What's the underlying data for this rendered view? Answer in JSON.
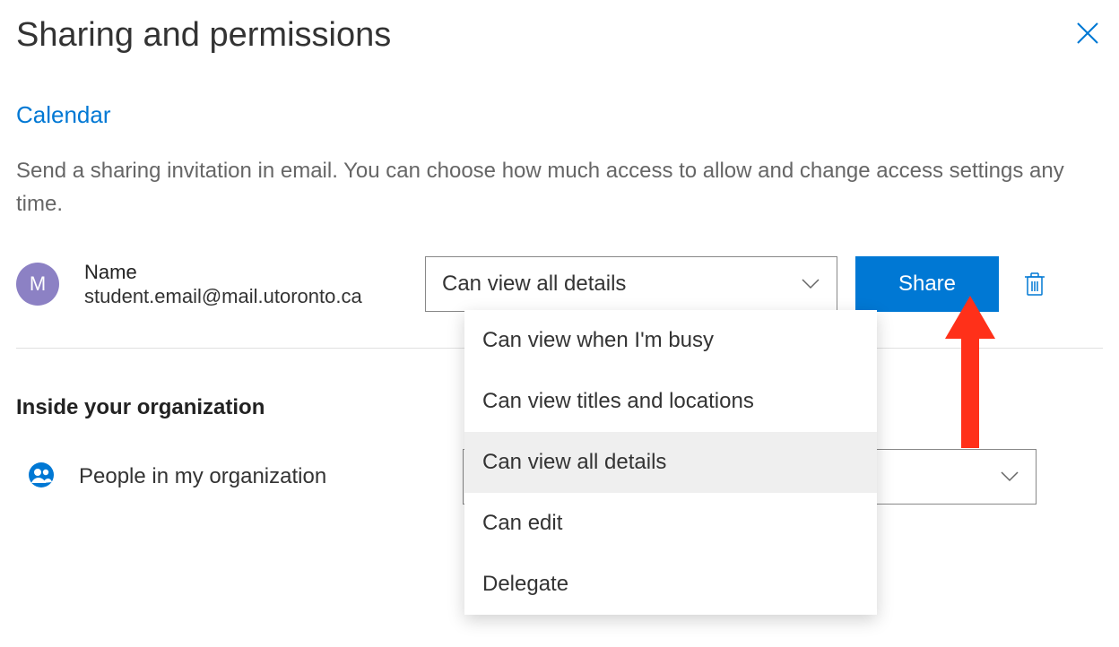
{
  "header": {
    "title": "Sharing and permissions"
  },
  "section": {
    "title": "Calendar",
    "description": "Send a sharing invitation in email. You can choose how much access to allow and change access settings any time."
  },
  "person": {
    "avatar_initial": "M",
    "name": "Name",
    "email": "student.email@mail.utoronto.ca",
    "permission_selected": "Can view all details"
  },
  "permission_options": [
    "Can view when I'm busy",
    "Can view titles and locations",
    "Can view all details",
    "Can edit",
    "Delegate"
  ],
  "share_button_label": "Share",
  "org_section": {
    "heading": "Inside your organization",
    "row_label": "People in my organization"
  },
  "colors": {
    "accent": "#0078d4",
    "avatar": "#8c81c4",
    "annotation": "#ff3019"
  }
}
